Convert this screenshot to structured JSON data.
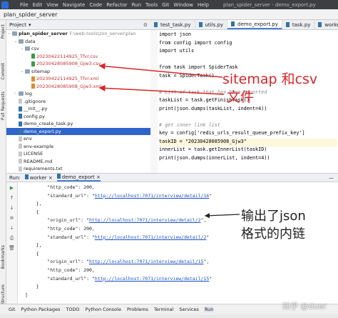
{
  "titlebar": {
    "menus": [
      "File",
      "Edit",
      "View",
      "Navigate",
      "Code",
      "Refactor",
      "Run",
      "Tools",
      "Git",
      "Window",
      "Help"
    ],
    "title": "plan_spider_server - demo_export.py"
  },
  "navbar": {
    "project": "plan_spider_server"
  },
  "side_tools": {
    "project": "Project",
    "commit": "Commit",
    "pull_requests": "Pull Requests",
    "bookmarks": "Bookmarks",
    "structure": "Structure"
  },
  "project_panel": {
    "title": "Project",
    "tree": [
      {
        "label": "plan_spider_server",
        "extra": "F:\\web-tools\\zon_server\\plan",
        "level": 0,
        "type": "folder"
      },
      {
        "label": "data",
        "level": 1,
        "type": "folder"
      },
      {
        "label": "csv",
        "level": 2,
        "type": "folder"
      },
      {
        "label": "20230422114925_Tfvr.csv",
        "level": 3,
        "type": "csv"
      },
      {
        "label": "20230428085908_Gjw3.csv",
        "level": 3,
        "type": "csv"
      },
      {
        "label": "sitemap",
        "level": 2,
        "type": "folder"
      },
      {
        "label": "20230422114925_Tfvr.xml",
        "level": 3,
        "type": "xml"
      },
      {
        "label": "20230428085908_Gjw3.xml",
        "level": 3,
        "type": "xml"
      },
      {
        "label": "log",
        "level": 1,
        "type": "folder"
      },
      {
        "label": ".gitignore",
        "level": 1,
        "type": "file"
      },
      {
        "label": "__init__.py",
        "level": 1,
        "type": "py"
      },
      {
        "label": "config.py",
        "level": 1,
        "type": "py"
      },
      {
        "label": "demo_create_task.py",
        "level": 1,
        "type": "py"
      },
      {
        "label": "demo_export.py",
        "level": 1,
        "type": "py"
      },
      {
        "label": "env",
        "level": 1,
        "type": "file"
      },
      {
        "label": "env-example",
        "level": 1,
        "type": "file"
      },
      {
        "label": "LICENSE",
        "level": 1,
        "type": "file"
      },
      {
        "label": "README.md",
        "level": 1,
        "type": "file"
      },
      {
        "label": "requirements.txt",
        "level": 1,
        "type": "file"
      }
    ]
  },
  "editor_tabs": [
    "test_task.py",
    "utils.py",
    "demo_export.py",
    "task.py",
    "worker.py"
  ],
  "code_lines": [
    "import json",
    "from config import config",
    "import utils",
    "",
    "from task import SpiderTask",
    "task = SpiderTask()",
    "",
    "# List of task that has been exported",
    "taskList = task.getFinishTask()",
    "print(json.dumps(taskList, indent=4))",
    "",
    "# get inner link list",
    "key = config['redis_urls_result_queue_prefix_key']",
    "taskID = \"20230428085908_Gjw3\"",
    "innerList = task.getInnerList(taskID)",
    "print(json.dumps(innerList, indent=4))"
  ],
  "annotations": {
    "sitemap_csv_line1": "sitemap 和csv",
    "sitemap_csv_line2": "文件",
    "json_line1": "输出了json",
    "json_line2": "格式的内链"
  },
  "run_panel": {
    "label": "Run:",
    "tabs": [
      "worker",
      "demo_export"
    ]
  },
  "console_lines": [
    {
      "text": "        \"http_code\": 200,",
      "url": ""
    },
    {
      "text": "        \"standard_url\": \"",
      "url": "http://localhost:7071/interview/detail/16",
      "tail": "\""
    },
    {
      "text": "    },",
      "url": ""
    },
    {
      "text": "    {",
      "url": ""
    },
    {
      "text": "        \"origin_url\": \"",
      "url": "http://localhost:7071/interview/detail/2",
      "tail": "\","
    },
    {
      "text": "        \"http_code\": 200,",
      "url": ""
    },
    {
      "text": "        \"standard_url\": \"",
      "url": "http://localhost:7071/interview/detail/2",
      "tail": "\""
    },
    {
      "text": "    },",
      "url": ""
    },
    {
      "text": "    {",
      "url": ""
    },
    {
      "text": "        \"origin_url\": \"",
      "url": "http://localhost:7071/interview/detail/15",
      "tail": "\","
    },
    {
      "text": "        \"http_code\": 200,",
      "url": ""
    },
    {
      "text": "        \"standard_url\": \"",
      "url": "http://localhost:7071/interview/detail/15",
      "tail": "\""
    },
    {
      "text": "    }",
      "url": ""
    },
    {
      "text": "]",
      "url": ""
    }
  ],
  "bottom_tabs": [
    "Git",
    "Python Packages",
    "TODO",
    "Python Console",
    "Problems",
    "Terminal",
    "Services",
    "Run"
  ],
  "watermark": "知乎 @duer"
}
